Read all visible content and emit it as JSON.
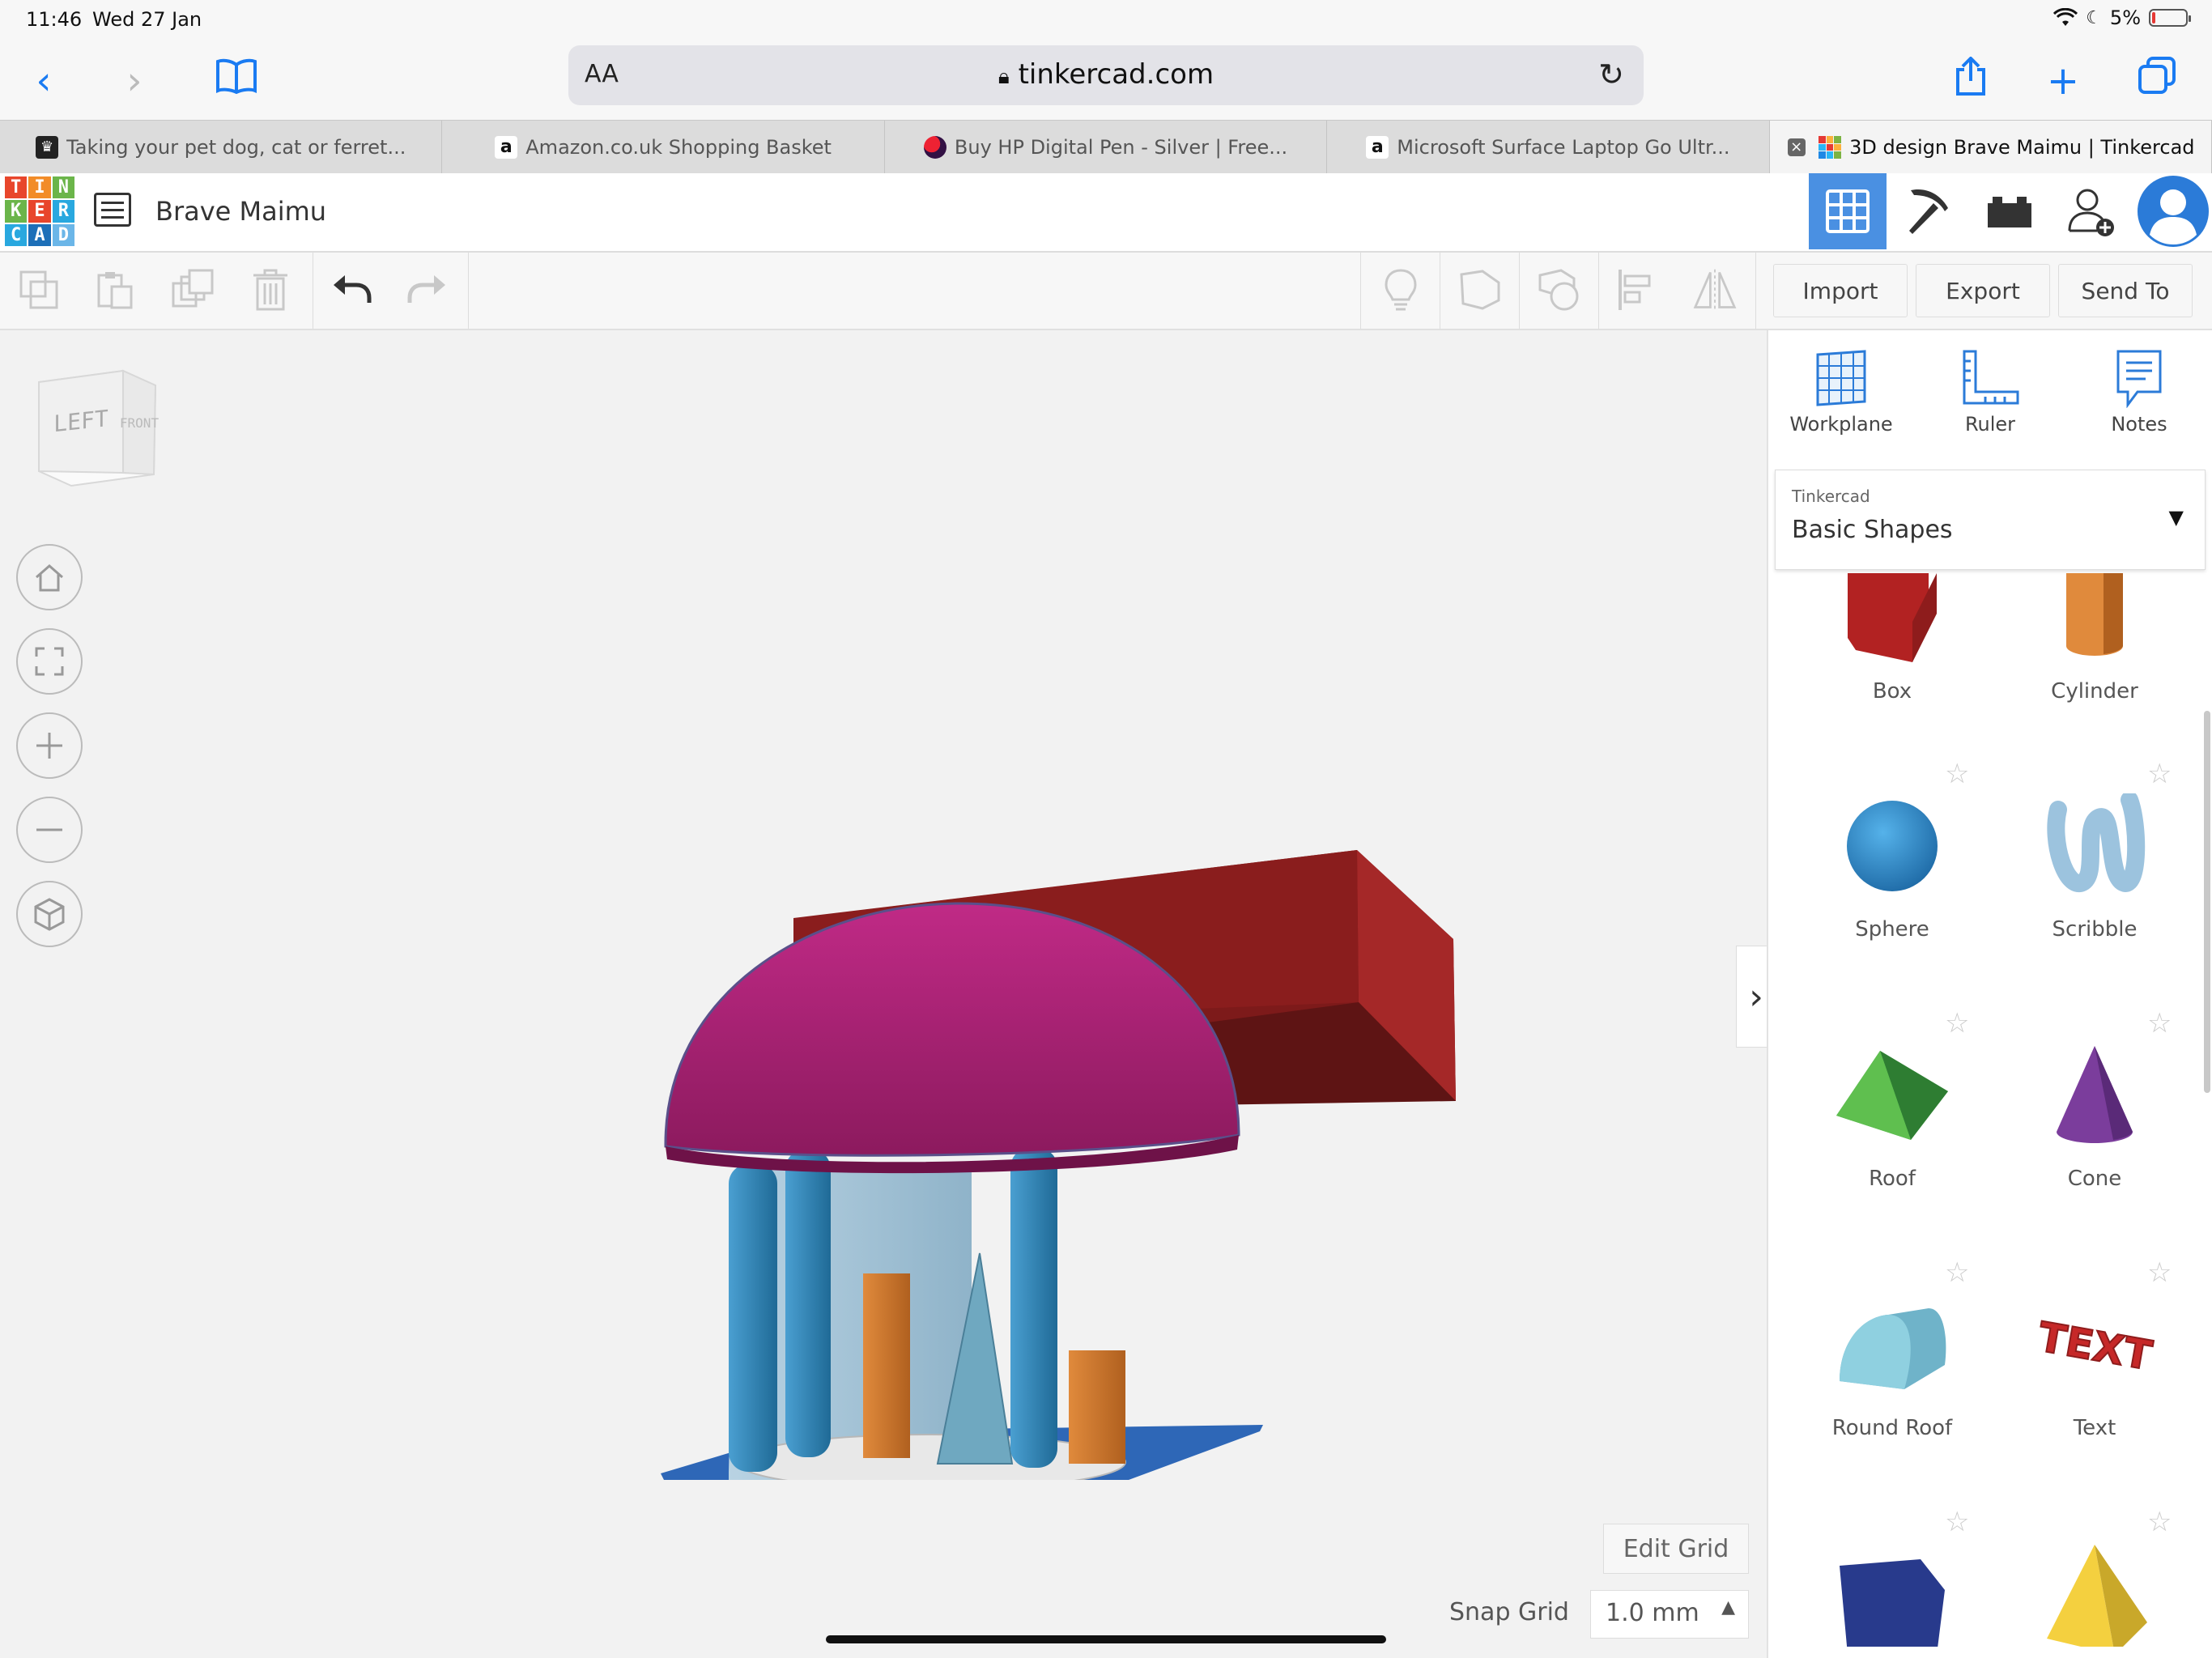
{
  "status": {
    "time": "11:46",
    "date": "Wed 27 Jan",
    "battery": "5%"
  },
  "browser": {
    "text_size": "AA",
    "url": "tinkercad.com",
    "tabs": [
      {
        "title": "Taking your pet dog, cat or ferret...",
        "active": false
      },
      {
        "title": "Amazon.co.uk Shopping Basket",
        "active": false
      },
      {
        "title": "Buy HP Digital Pen - Silver | Free...",
        "active": false
      },
      {
        "title": "Microsoft Surface Laptop Go Ultr...",
        "active": false
      },
      {
        "title": "3D design Brave Maimu | Tinkercad",
        "active": true
      }
    ]
  },
  "app": {
    "logo_letters": [
      "T",
      "I",
      "N",
      "K",
      "E",
      "R",
      "C",
      "A",
      "D"
    ],
    "design_name": "Brave Maimu",
    "toolbar": {
      "import": "Import",
      "export": "Export",
      "send_to": "Send To"
    },
    "viewcube": {
      "left": "LEFT",
      "front": "FRONT"
    },
    "sidebar": {
      "tools": [
        "Workplane",
        "Ruler",
        "Notes"
      ],
      "library_source": "Tinkercad",
      "library_name": "Basic Shapes",
      "shapes": [
        "Box",
        "Cylinder",
        "Sphere",
        "Scribble",
        "Roof",
        "Cone",
        "Round Roof",
        "Text"
      ]
    },
    "grid": {
      "edit_label": "Edit Grid",
      "snap_label": "Snap Grid",
      "snap_value": "1.0 mm"
    }
  },
  "colors": {
    "accent": "#1a7bf2",
    "active_view": "#4a90e2",
    "dome": "#b8237a",
    "box": "#8e1c1c",
    "pillar": "#2f7dab"
  }
}
